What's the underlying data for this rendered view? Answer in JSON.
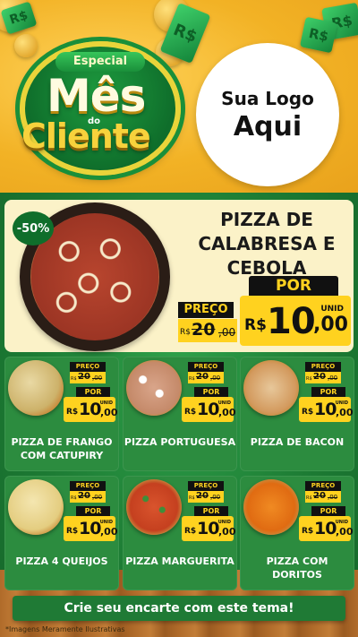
{
  "header": {
    "badge": {
      "top": "Especial",
      "line1": "Mês",
      "small": "do",
      "line2": "Cliente"
    },
    "logo": {
      "line1": "Sua Logo",
      "line2": "Aqui"
    },
    "money_symbol": "R$"
  },
  "featured": {
    "discount": "-50%",
    "title": "PIZZA DE CALABRESA E CEBOLA",
    "preco_label": "PREÇO",
    "old_currency": "R$",
    "old_int": "20",
    "old_dec": ",00",
    "por_label": "POR",
    "unit": "UNID",
    "currency": "R$",
    "price_int": "10",
    "price_dec": ",00"
  },
  "products": [
    {
      "name": "PIZZA DE FRANGO COM CATUPIRY",
      "preco": "PREÇO",
      "old_rs": "R$",
      "old_int": "20",
      "old_dec": ",00",
      "por": "POR",
      "rs": "R$",
      "int": "10",
      "dec": ",00",
      "unit": "UNID"
    },
    {
      "name": "PIZZA PORTUGUESA",
      "preco": "PREÇO",
      "old_rs": "R$",
      "old_int": "20",
      "old_dec": ",00",
      "por": "POR",
      "rs": "R$",
      "int": "10",
      "dec": ",00",
      "unit": "UNID"
    },
    {
      "name": "PIZZA DE BACON",
      "preco": "PREÇO",
      "old_rs": "R$",
      "old_int": "20",
      "old_dec": ",00",
      "por": "POR",
      "rs": "R$",
      "int": "10",
      "dec": ",00",
      "unit": "UNID"
    },
    {
      "name": "PIZZA 4 QUEIJOS",
      "preco": "PREÇO",
      "old_rs": "R$",
      "old_int": "20",
      "old_dec": ",00",
      "por": "POR",
      "rs": "R$",
      "int": "10",
      "dec": ",00",
      "unit": "UNID"
    },
    {
      "name": "PIZZA MARGUERITA",
      "preco": "PREÇO",
      "old_rs": "R$",
      "old_int": "20",
      "old_dec": ",00",
      "por": "POR",
      "rs": "R$",
      "int": "10",
      "dec": ",00",
      "unit": "UNID"
    },
    {
      "name": "PIZZA COM DORITOS",
      "preco": "PREÇO",
      "old_rs": "R$",
      "old_int": "20",
      "old_dec": ",00",
      "por": "POR",
      "rs": "R$",
      "int": "10",
      "dec": ",00",
      "unit": "UNID"
    }
  ],
  "footer": {
    "cta": "Crie seu encarte com este tema!",
    "disclaimer": "*Imagens Meramente Ilustrativas"
  },
  "colors": {
    "green": "#1c7a33",
    "yellow": "#ffd21f",
    "orange": "#f2b225",
    "black": "#111111"
  }
}
